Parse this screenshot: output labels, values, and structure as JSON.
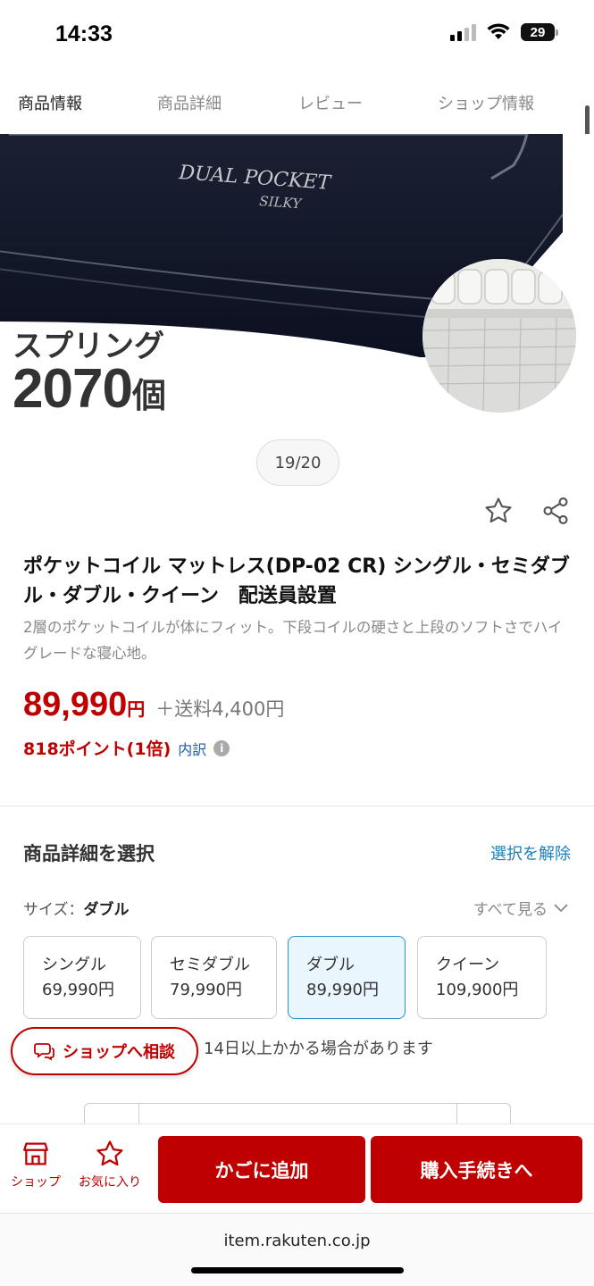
{
  "status": {
    "time": "14:33",
    "battery": "29"
  },
  "tabs": [
    {
      "label": "商品情報",
      "active": true
    },
    {
      "label": "商品詳細"
    },
    {
      "label": "レビュー"
    },
    {
      "label": "ショップ情報"
    }
  ],
  "hero": {
    "mattress_brand": "DUAL POCKET",
    "mattress_sub": "SILKY",
    "spring_label": "スプリング",
    "spring_count": "2070",
    "spring_unit": "個",
    "pager": "19/20"
  },
  "product": {
    "title": "ポケットコイル マットレス(DP-02 CR) シングル・セミダブル・ダブル・クイーン　配送員設置",
    "description": "2層のポケットコイルが体にフィット。下段コイルの硬さと上段のソフトさでハイグレードな寝心地。",
    "price": "89,990",
    "price_unit": "円",
    "shipping": "＋送料4,400円",
    "points": "818ポイント(1倍)",
    "breakdown": "内訳"
  },
  "selection": {
    "title": "商品詳細を選択",
    "clear": "選択を解除",
    "size_prefix": "サイズ：",
    "size_value": "ダブル",
    "see_all": "すべて見る",
    "options": [
      {
        "name": "シングル",
        "price": "69,990円"
      },
      {
        "name": "セミダブル",
        "price": "79,990円"
      },
      {
        "name": "ダブル",
        "price": "89,990円"
      },
      {
        "name": "クイーン",
        "price": "109,900円"
      }
    ],
    "delivery_note": "14日以上かかる場合があります",
    "consult": "ショップへ相談"
  },
  "bottom": {
    "shop": "ショップ",
    "favorite": "お気に入り",
    "cart": "かごに追加",
    "buy": "購入手続きへ"
  },
  "url": "item.rakuten.co.jp",
  "colors": {
    "accent": "#bf0000",
    "link": "#1a7fb8",
    "selected_border": "#2a93c9"
  }
}
